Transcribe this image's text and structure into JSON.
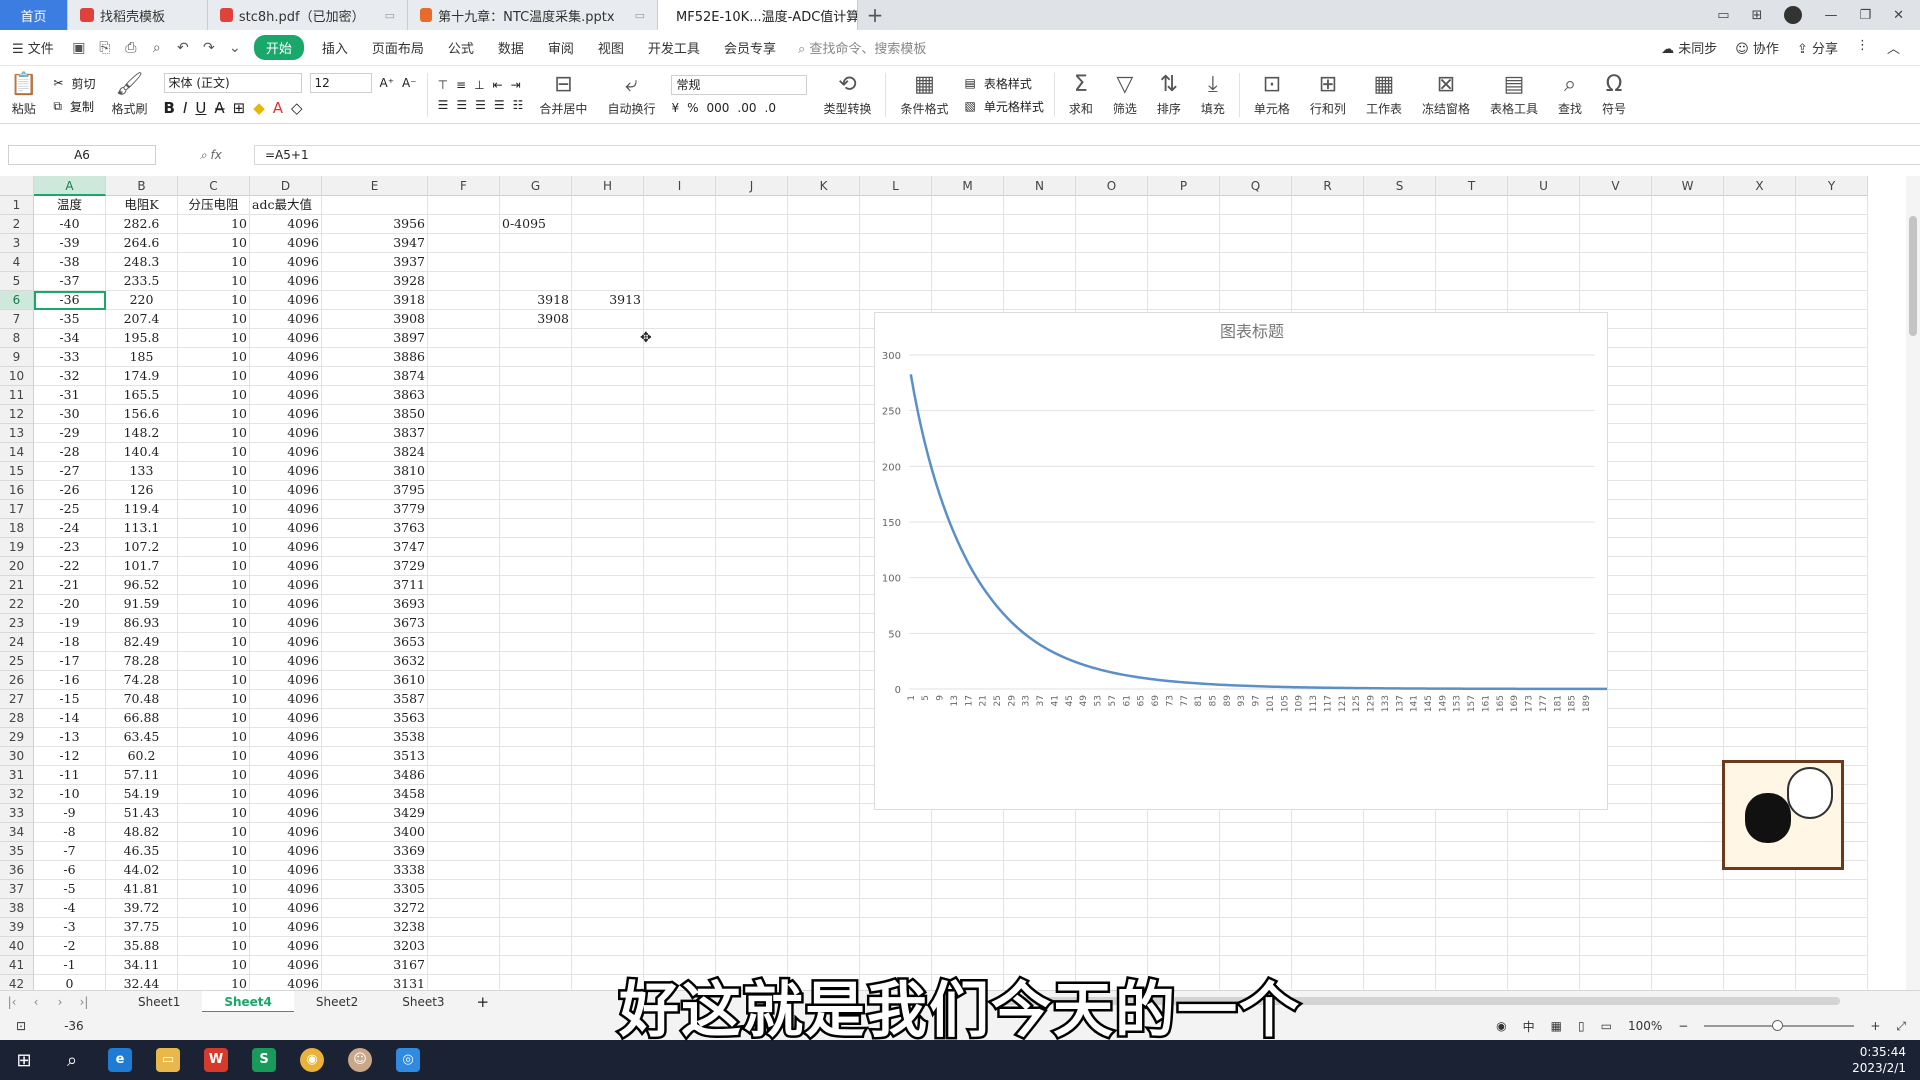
{
  "tabs": [
    {
      "label": "首页",
      "type": "home"
    },
    {
      "label": "找稻壳模板",
      "type": "norm",
      "icon_color": "#e0413a"
    },
    {
      "label": "stc8h.pdf（已加密）",
      "type": "norm",
      "icon_color": "#e0413a"
    },
    {
      "label": "第十九章：NTC温度采集.pptx",
      "type": "norm",
      "icon_color": "#e86b2b"
    },
    {
      "label": "MF52E-10K...温度-ADC值计算",
      "type": "active",
      "icon_color": "#1aa86a"
    }
  ],
  "menu": {
    "file": "文件",
    "start": "开始",
    "items": [
      "插入",
      "页面布局",
      "公式",
      "数据",
      "审阅",
      "视图",
      "开发工具",
      "会员专享"
    ],
    "search_placeholder": "查找命令、搜索模板",
    "right": [
      "未同步",
      "协作",
      "分享"
    ]
  },
  "ribbon": {
    "paste": "粘贴",
    "cut": "剪切",
    "copy": "复制",
    "format_painter": "格式刷",
    "font_name": "宋体 (正文)",
    "font_size": "12",
    "merge": "合并居中",
    "wrap": "自动换行",
    "num_format": "常规",
    "type_convert": "类型转换",
    "cond_format": "条件格式",
    "table_style": "表格样式",
    "cell_style": "单元格样式",
    "sum": "求和",
    "filter": "筛选",
    "sort": "排序",
    "fill": "填充",
    "cell": "单元格",
    "rowcol": "行和列",
    "sheet": "工作表",
    "freeze": "冻结窗格",
    "table_tools": "表格工具",
    "find": "查找",
    "symbol": "符号"
  },
  "namebox": "A6",
  "formula": "=A5+1",
  "columns": [
    "A",
    "B",
    "C",
    "D",
    "E",
    "F",
    "G",
    "H",
    "I",
    "J",
    "K",
    "L",
    "M",
    "N",
    "O",
    "P",
    "Q",
    "R",
    "S",
    "T",
    "U",
    "V",
    "W",
    "X",
    "Y"
  ],
  "headers": [
    "温度",
    "电阻K",
    "分压电阻",
    "adc最大值"
  ],
  "rows": [
    [
      "-40",
      "282.6",
      "10",
      "4096",
      "3956",
      "0-4095",
      ""
    ],
    [
      "-39",
      "264.6",
      "10",
      "4096",
      "3947",
      "",
      ""
    ],
    [
      "-38",
      "248.3",
      "10",
      "4096",
      "3937",
      "",
      ""
    ],
    [
      "-37",
      "233.5",
      "10",
      "4096",
      "3928",
      "",
      ""
    ],
    [
      "-36",
      "220",
      "10",
      "4096",
      "3918",
      "3918",
      "3913"
    ],
    [
      "-35",
      "207.4",
      "10",
      "4096",
      "3908",
      "3908",
      ""
    ],
    [
      "-34",
      "195.8",
      "10",
      "4096",
      "3897",
      "",
      ""
    ],
    [
      "-33",
      "185",
      "10",
      "4096",
      "3886",
      "",
      ""
    ],
    [
      "-32",
      "174.9",
      "10",
      "4096",
      "3874",
      "",
      ""
    ],
    [
      "-31",
      "165.5",
      "10",
      "4096",
      "3863",
      "",
      ""
    ],
    [
      "-30",
      "156.6",
      "10",
      "4096",
      "3850",
      "",
      ""
    ],
    [
      "-29",
      "148.2",
      "10",
      "4096",
      "3837",
      "",
      ""
    ],
    [
      "-28",
      "140.4",
      "10",
      "4096",
      "3824",
      "",
      ""
    ],
    [
      "-27",
      "133",
      "10",
      "4096",
      "3810",
      "",
      ""
    ],
    [
      "-26",
      "126",
      "10",
      "4096",
      "3795",
      "",
      ""
    ],
    [
      "-25",
      "119.4",
      "10",
      "4096",
      "3779",
      "",
      ""
    ],
    [
      "-24",
      "113.1",
      "10",
      "4096",
      "3763",
      "",
      ""
    ],
    [
      "-23",
      "107.2",
      "10",
      "4096",
      "3747",
      "",
      ""
    ],
    [
      "-22",
      "101.7",
      "10",
      "4096",
      "3729",
      "",
      ""
    ],
    [
      "-21",
      "96.52",
      "10",
      "4096",
      "3711",
      "",
      ""
    ],
    [
      "-20",
      "91.59",
      "10",
      "4096",
      "3693",
      "",
      ""
    ],
    [
      "-19",
      "86.93",
      "10",
      "4096",
      "3673",
      "",
      ""
    ],
    [
      "-18",
      "82.49",
      "10",
      "4096",
      "3653",
      "",
      ""
    ],
    [
      "-17",
      "78.28",
      "10",
      "4096",
      "3632",
      "",
      ""
    ],
    [
      "-16",
      "74.28",
      "10",
      "4096",
      "3610",
      "",
      ""
    ],
    [
      "-15",
      "70.48",
      "10",
      "4096",
      "3587",
      "",
      ""
    ],
    [
      "-14",
      "66.88",
      "10",
      "4096",
      "3563",
      "",
      ""
    ],
    [
      "-13",
      "63.45",
      "10",
      "4096",
      "3538",
      "",
      ""
    ],
    [
      "-12",
      "60.2",
      "10",
      "4096",
      "3513",
      "",
      ""
    ],
    [
      "-11",
      "57.11",
      "10",
      "4096",
      "3486",
      "",
      ""
    ],
    [
      "-10",
      "54.19",
      "10",
      "4096",
      "3458",
      "",
      ""
    ],
    [
      "-9",
      "51.43",
      "10",
      "4096",
      "3429",
      "",
      ""
    ],
    [
      "-8",
      "48.82",
      "10",
      "4096",
      "3400",
      "",
      ""
    ],
    [
      "-7",
      "46.35",
      "10",
      "4096",
      "3369",
      "",
      ""
    ],
    [
      "-6",
      "44.02",
      "10",
      "4096",
      "3338",
      "",
      ""
    ],
    [
      "-5",
      "41.81",
      "10",
      "4096",
      "3305",
      "",
      ""
    ],
    [
      "-4",
      "39.72",
      "10",
      "4096",
      "3272",
      "",
      ""
    ],
    [
      "-3",
      "37.75",
      "10",
      "4096",
      "3238",
      "",
      ""
    ],
    [
      "-2",
      "35.88",
      "10",
      "4096",
      "3203",
      "",
      ""
    ],
    [
      "-1",
      "34.11",
      "10",
      "4096",
      "3167",
      "",
      ""
    ],
    [
      "0",
      "32.44",
      "10",
      "4096",
      "3131",
      "",
      ""
    ]
  ],
  "chart_data": {
    "type": "line",
    "title": "图表标题",
    "ylim": [
      0,
      300
    ],
    "yticks": [
      0,
      50,
      100,
      150,
      200,
      250,
      300
    ],
    "xticks": [
      1,
      5,
      9,
      13,
      17,
      21,
      25,
      29,
      33,
      37,
      41,
      45,
      49,
      53,
      57,
      61,
      65,
      69,
      73,
      77,
      81,
      85,
      89,
      93,
      97,
      101,
      105,
      109,
      113,
      117,
      121,
      125,
      129,
      133,
      137,
      141,
      145,
      149,
      153,
      157,
      161,
      165,
      169,
      173,
      177,
      181,
      185,
      189
    ],
    "x_count": 191,
    "series": [
      {
        "values": [
          282.6,
          264.6,
          248.3,
          233.5,
          220,
          207.4,
          195.8,
          185,
          174.9,
          165.5,
          156.6,
          148.2,
          140.4,
          133,
          126,
          119.4,
          113.1,
          107.2,
          101.7,
          96.52,
          91.59,
          86.93,
          82.49,
          78.28,
          74.28,
          70.48,
          66.88,
          63.45,
          60.2,
          57.11,
          54.19,
          51.43,
          48.82,
          46.35,
          44.02,
          41.81,
          39.72,
          37.75,
          35.88,
          34.11,
          32.44,
          30.85,
          29.35,
          27.93,
          26.58,
          25.3,
          24.08,
          22.93,
          21.84,
          20.8,
          19.81,
          18.87,
          17.98,
          17.14,
          16.33,
          15.56,
          14.84,
          14.15,
          13.49,
          12.87,
          12.28,
          11.72,
          11.19,
          10.68,
          10.2,
          9.745,
          9.311,
          8.9,
          8.507,
          8.133,
          7.776,
          7.437,
          7.113,
          6.804,
          6.51,
          6.23,
          5.962,
          5.707,
          5.463,
          5.231,
          5.009,
          4.797,
          4.594,
          4.401,
          4.216,
          4.04,
          3.871,
          3.71,
          3.556,
          3.409,
          3.268,
          3.133,
          3.004,
          2.881,
          2.763,
          2.65,
          2.542,
          2.438,
          2.339,
          2.244,
          2.153,
          2.066,
          1.983,
          1.903,
          1.827,
          1.754,
          1.684,
          1.617,
          1.553,
          1.492,
          1.433,
          1.377,
          1.323,
          1.271,
          1.222,
          1.174,
          1.129,
          1.085,
          1.043,
          1.003,
          0.965,
          0.928,
          0.893,
          0.859,
          0.826,
          0.795,
          0.765,
          0.736,
          0.709,
          0.682,
          0.657,
          0.632,
          0.609,
          0.586,
          0.565,
          0.544,
          0.524,
          0.505,
          0.486,
          0.469,
          0.452,
          0.435,
          0.42,
          0.405,
          0.39,
          0.376,
          0.363,
          0.35,
          0.338,
          0.326,
          0.314,
          0.303,
          0.293,
          0.283,
          0.273,
          0.264,
          0.255,
          0.246,
          0.238,
          0.23,
          0.222,
          0.214,
          0.207,
          0.2,
          0.194,
          0.187,
          0.181,
          0.175,
          0.169,
          0.164,
          0.159,
          0.153,
          0.148,
          0.144,
          0.139,
          0.135,
          0.13,
          0.126,
          0.122,
          0.118,
          0.115,
          0.111,
          0.108,
          0.104,
          0.101,
          0.098,
          0.095,
          0.092,
          0.089,
          0.087,
          0.084,
          0.082,
          0.079,
          0.077,
          0.075,
          0.072
        ]
      }
    ],
    "color": "#5b8fc8"
  },
  "sheets": [
    "Sheet1",
    "Sheet4",
    "Sheet2",
    "Sheet3"
  ],
  "active_sheet": "Sheet4",
  "status": {
    "value": "-36",
    "zoom": "100%"
  },
  "subtitle": "好这就是我们今天的一个",
  "clock": {
    "time": "0:35:44",
    "date": "2023/2/1"
  }
}
